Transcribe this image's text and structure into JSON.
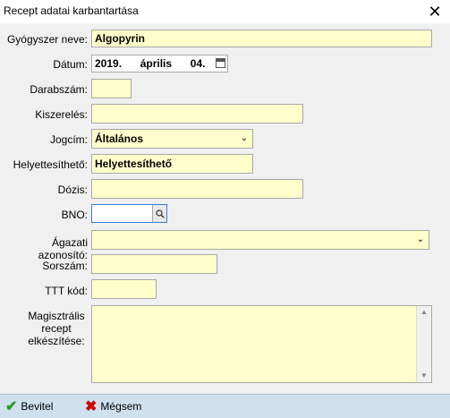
{
  "window": {
    "title": "Recept adatai karbantartása",
    "close_glyph": "✕"
  },
  "form": {
    "drug_name": {
      "label": "Gyógyszer neve:",
      "value": "Algopyrin"
    },
    "date": {
      "label": "Dátum:",
      "year": "2019.",
      "month": "április",
      "day": "04."
    },
    "quantity": {
      "label": "Darabszám:",
      "value": ""
    },
    "packaging": {
      "label": "Kiszerelés:",
      "value": ""
    },
    "entitlement": {
      "label": "Jogcím:",
      "value": "Általános"
    },
    "substitutable": {
      "label": "Helyettesíthető:",
      "value": "Helyettesíthető"
    },
    "dose": {
      "label": "Dózis:",
      "value": ""
    },
    "bno": {
      "label": "BNO:",
      "value": ""
    },
    "sector_id": {
      "label": "Ágazati azonosító:",
      "value": ""
    },
    "serial": {
      "label": "Sorszám:",
      "value": ""
    },
    "ttt_code": {
      "label": "TTT kód:",
      "value": ""
    },
    "magistral": {
      "label_line1": "Magisztrális",
      "label_line2": "recept",
      "label_line3": "elkészítése:",
      "value": ""
    }
  },
  "buttons": {
    "ok_label": "Bevitel",
    "cancel_label": "Mégsem"
  },
  "icons": {
    "ok": "check-icon",
    "cancel": "x-icon",
    "calendar": "calendar-icon",
    "search": "search-icon",
    "dropdown": "chevron-down-icon"
  },
  "colors": {
    "field_bg": "#ffffcc",
    "window_bg": "#f0f0f0",
    "bottom_bar": "#cfe0ef"
  }
}
